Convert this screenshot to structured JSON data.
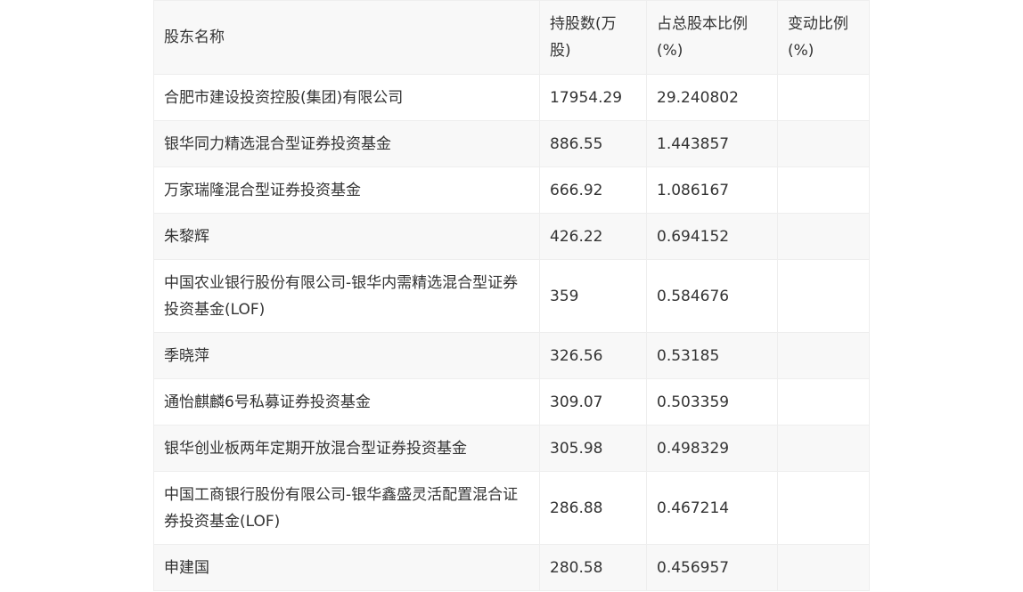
{
  "table": {
    "headers": [
      "股东名称",
      "持股数(万股)",
      "占总股本比例(%)",
      "变动比例(%)"
    ],
    "rows": [
      {
        "name": "合肥市建设投资控股(集团)有限公司",
        "shares": "17954.29",
        "ratio": "29.240802",
        "change": ""
      },
      {
        "name": "银华同力精选混合型证券投资基金",
        "shares": "886.55",
        "ratio": "1.443857",
        "change": ""
      },
      {
        "name": "万家瑞隆混合型证券投资基金",
        "shares": "666.92",
        "ratio": "1.086167",
        "change": ""
      },
      {
        "name": "朱黎辉",
        "shares": "426.22",
        "ratio": "0.694152",
        "change": ""
      },
      {
        "name": "中国农业银行股份有限公司-银华内需精选混合型证券投资基金(LOF)",
        "shares": "359",
        "ratio": "0.584676",
        "change": ""
      },
      {
        "name": "季晓萍",
        "shares": "326.56",
        "ratio": "0.53185",
        "change": ""
      },
      {
        "name": "通怡麒麟6号私募证券投资基金",
        "shares": "309.07",
        "ratio": "0.503359",
        "change": ""
      },
      {
        "name": "银华创业板两年定期开放混合型证券投资基金",
        "shares": "305.98",
        "ratio": "0.498329",
        "change": ""
      },
      {
        "name": "中国工商银行股份有限公司-银华鑫盛灵活配置混合证券投资基金(LOF)",
        "shares": "286.88",
        "ratio": "0.467214",
        "change": ""
      },
      {
        "name": "申建国",
        "shares": "280.58",
        "ratio": "0.456957",
        "change": ""
      }
    ]
  }
}
